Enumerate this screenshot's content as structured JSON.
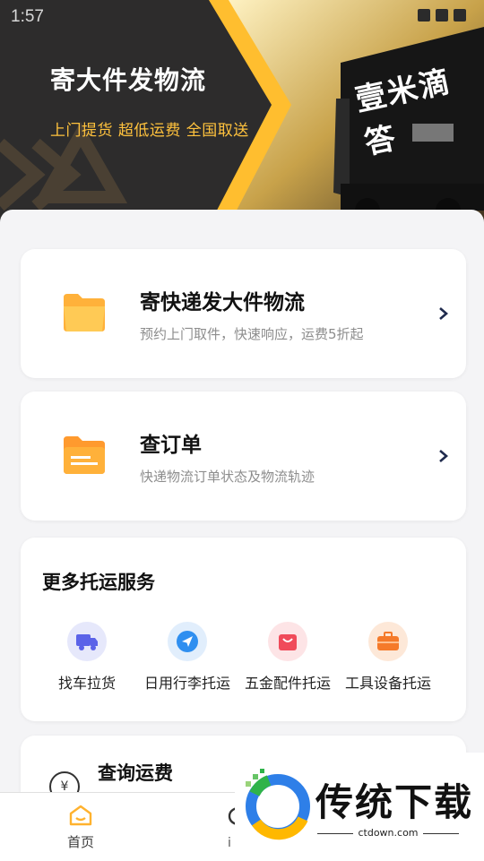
{
  "status_bar": {
    "time": "1:57"
  },
  "banner": {
    "title": "寄大件发物流",
    "subtitle": "上门提货  超低运费  全国取送",
    "truck_logo": "壹米滴答"
  },
  "cards": [
    {
      "title": "寄快递发大件物流",
      "desc": "预约上门取件，快速响应，运费5折起",
      "icon": "folder-icon"
    },
    {
      "title": "查订单",
      "desc": "快递物流订单状态及物流轨迹",
      "icon": "document-folder-icon"
    }
  ],
  "more_services": {
    "title": "更多托运服务",
    "items": [
      {
        "label": "找车拉货",
        "icon": "truck-icon",
        "color": "#5b63e8"
      },
      {
        "label": "日用行李托运",
        "icon": "navigation-arrow-icon",
        "color": "#2f8ff0"
      },
      {
        "label": "五金配件托运",
        "icon": "shopping-bag-icon",
        "color": "#f04b5a"
      },
      {
        "label": "工具设备托运",
        "icon": "toolbox-icon",
        "color": "#f57a2a"
      }
    ]
  },
  "fee": {
    "title": "查询运费",
    "icon": "yen-icon",
    "symbol": "¥"
  },
  "tabbar": {
    "home_label": "首页"
  },
  "watermark": {
    "text": "传统下载",
    "url": "ctdown.com"
  },
  "colors": {
    "accent": "#ffb92e",
    "banner_bg": "#2d2c2c"
  }
}
